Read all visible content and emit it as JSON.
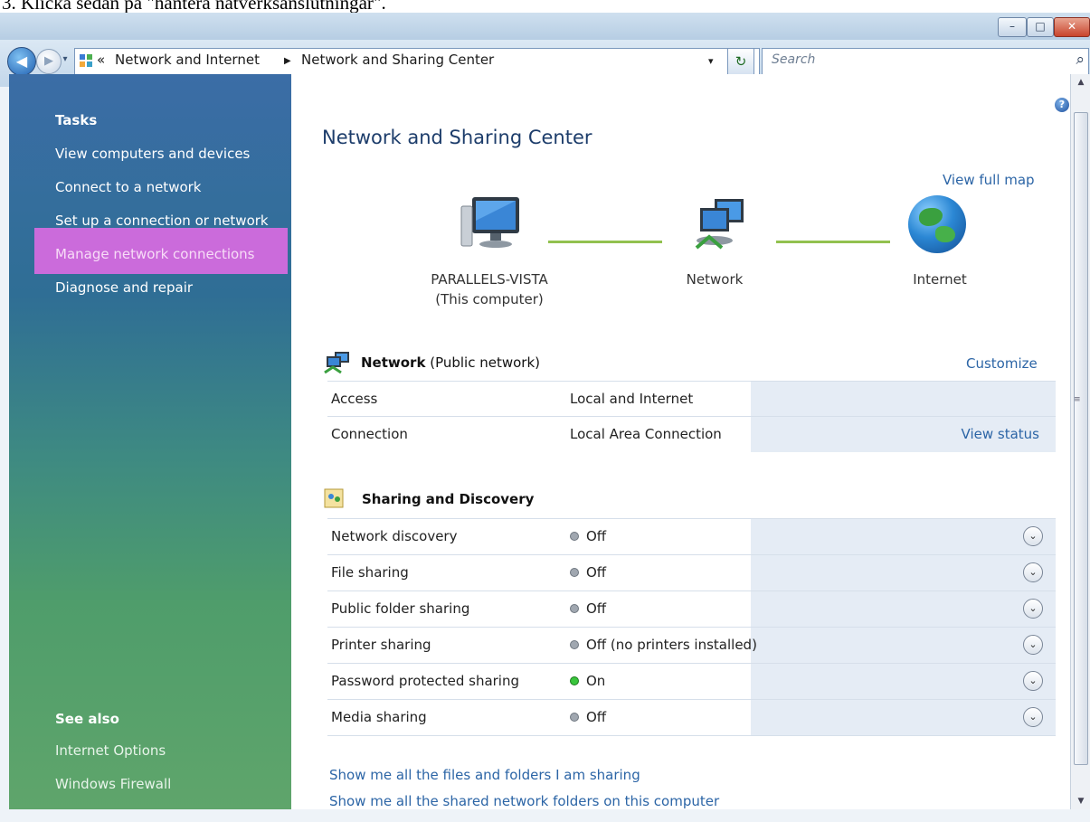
{
  "caption": "3. Klicka sedan på \"hantera nätverksanslutningar\".",
  "window": {
    "buttons": {
      "minimize": "–",
      "maximize": "□",
      "close": "✕"
    }
  },
  "nav": {
    "back_glyph": "◀",
    "forward_glyph": "▶",
    "dropdown_glyph": "▾"
  },
  "address": {
    "chevron": "«",
    "crumb1": "Network and Internet",
    "separator": "▶",
    "crumb2": "Network and Sharing Center",
    "dropdown_glyph": "▾",
    "refresh_glyph": "↻"
  },
  "search": {
    "placeholder": "Search",
    "icon": "search-icon",
    "glyph": "⌕"
  },
  "sidebar": {
    "tasks_heading": "Tasks",
    "tasks": [
      {
        "label": "View computers and devices"
      },
      {
        "label": "Connect to a network"
      },
      {
        "label": "Set up a connection or network"
      },
      {
        "label": "Manage network connections"
      },
      {
        "label": "Diagnose and repair"
      }
    ],
    "see_also_heading": "See also",
    "see_also": [
      {
        "label": "Internet Options"
      },
      {
        "label": "Windows Firewall"
      }
    ],
    "highlight_color": "#e66be6"
  },
  "main": {
    "help_glyph": "?",
    "title": "Network and Sharing Center",
    "view_full_map": "View full map",
    "map": {
      "computer_line1": "PARALLELS-VISTA",
      "computer_line2": "(This computer)",
      "network": "Network",
      "internet": "Internet"
    },
    "network_section": {
      "name": "Network",
      "type": "(Public network)",
      "customize": "Customize",
      "rows": [
        {
          "label": "Access",
          "value": "Local and Internet",
          "link": ""
        },
        {
          "label": "Connection",
          "value": "Local Area Connection",
          "link": "View status"
        }
      ]
    },
    "sharing_section": {
      "title": "Sharing and Discovery",
      "rows": [
        {
          "label": "Network discovery",
          "value": "Off",
          "state": "off"
        },
        {
          "label": "File sharing",
          "value": "Off",
          "state": "off"
        },
        {
          "label": "Public folder sharing",
          "value": "Off",
          "state": "off"
        },
        {
          "label": "Printer sharing",
          "value": "Off (no printers installed)",
          "state": "off"
        },
        {
          "label": "Password protected sharing",
          "value": "On",
          "state": "on"
        },
        {
          "label": "Media sharing",
          "value": "Off",
          "state": "off"
        }
      ],
      "expand_glyph": "⌄"
    },
    "links": [
      "Show me all the files and folders I am sharing",
      "Show me all the shared network folders on this computer"
    ]
  },
  "scrollbar": {
    "up": "▲",
    "down": "▼",
    "grip": "≡"
  },
  "colors": {
    "link": "#2c65a6",
    "title": "#1d3d6b",
    "wire": "#92c14f",
    "status_on": "#39c53c",
    "status_off": "#a0a7b0"
  }
}
